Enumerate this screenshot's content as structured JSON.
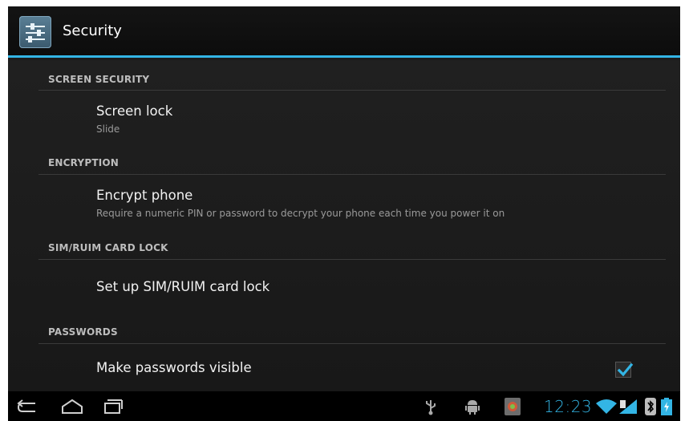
{
  "action_bar": {
    "title": "Security",
    "icon": "settings-sliders-icon",
    "accent": "#33b5e5"
  },
  "sections": [
    {
      "header": "SCREEN SECURITY",
      "title": "Screen lock",
      "summary": "Slide"
    },
    {
      "header": "ENCRYPTION",
      "title": "Encrypt phone",
      "summary": "Require a numeric PIN or password to decrypt your phone each time you power it on"
    },
    {
      "header": "SIM/RUIM CARD LOCK",
      "title": "Set up SIM/RUIM card lock"
    },
    {
      "header": "PASSWORDS",
      "title": "Make passwords visible",
      "checked": true
    }
  ],
  "system_bar": {
    "nav": [
      "back-icon",
      "home-icon",
      "recent-apps-icon"
    ],
    "status_icons": [
      "usb-icon",
      "android-debug-icon",
      "notification-app-icon",
      "wifi-icon",
      "signal-icon",
      "bluetooth-icon",
      "battery-charging-icon"
    ],
    "clock": "12:23",
    "clock_color": "#33b5e5"
  }
}
